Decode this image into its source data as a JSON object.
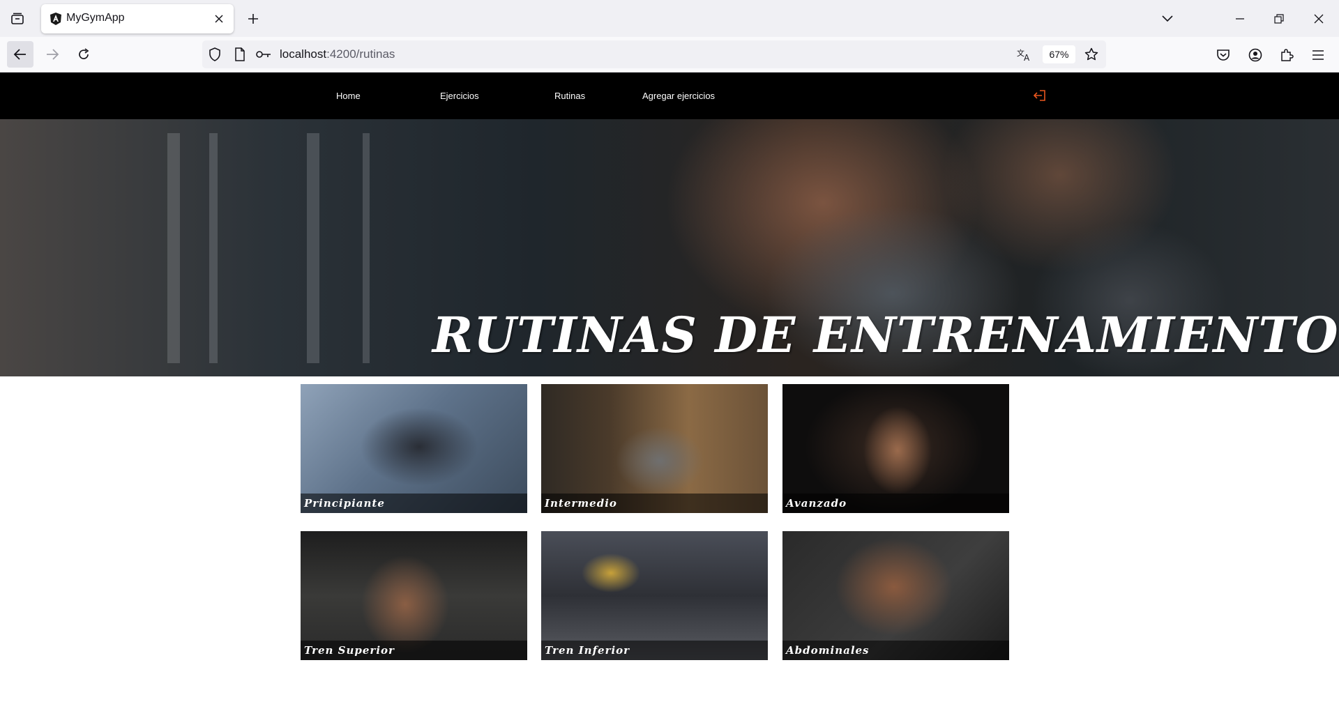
{
  "browser": {
    "tab_title": "MyGymApp",
    "url_host": "localhost",
    "url_path": ":4200/rutinas",
    "zoom": "67%"
  },
  "site": {
    "nav": {
      "home": "Home",
      "ejercicios": "Ejercicios",
      "rutinas": "Rutinas",
      "agregar": "Agregar ejercicios"
    },
    "accent_color": "#e8561e",
    "hero_title": "RUTINAS DE ENTRENAMIENTO",
    "cards": [
      {
        "label": "Principiante"
      },
      {
        "label": "Intermedio"
      },
      {
        "label": "Avanzado"
      },
      {
        "label": "Tren Superior"
      },
      {
        "label": "Tren Inferior"
      },
      {
        "label": "Abdominales"
      }
    ]
  }
}
